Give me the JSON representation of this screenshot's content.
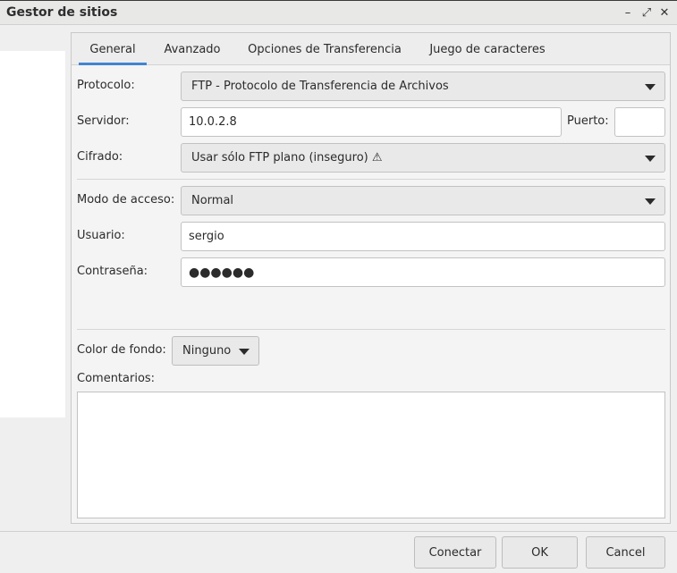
{
  "window": {
    "title": "Gestor de sitios",
    "controls": [
      "minimize-icon",
      "maximize-icon",
      "close-icon"
    ],
    "control_glyphs": [
      "–",
      "⤢",
      "✕"
    ]
  },
  "tabs": [
    {
      "label": "General",
      "active": true
    },
    {
      "label": "Avanzado",
      "active": false
    },
    {
      "label": "Opciones de Transferencia",
      "active": false
    },
    {
      "label": "Juego de caracteres",
      "active": false
    }
  ],
  "form": {
    "protocol_label": "Protocolo:",
    "protocol_value": "FTP - Protocolo de Transferencia de Archivos",
    "server_label": "Servidor:",
    "server_value": "10.0.2.8",
    "port_label": "Puerto:",
    "port_value": "",
    "encryption_label": "Cifrado:",
    "encryption_value": "Usar sólo FTP plano (inseguro) ⚠",
    "access_label": "Modo de acceso:",
    "access_value": "Normal",
    "user_label": "Usuario:",
    "user_value": "sergio",
    "password_label": "Contraseña:",
    "password_value": "●●●●●●",
    "bg_color_label": "Color de fondo:",
    "bg_color_value": "Ninguno",
    "comments_label": "Comentarios:",
    "comments_value": ""
  },
  "buttons": {
    "connect": "Conectar",
    "ok": "OK",
    "cancel": "Cancel"
  },
  "colors": {
    "accent": "#3f86d0"
  }
}
